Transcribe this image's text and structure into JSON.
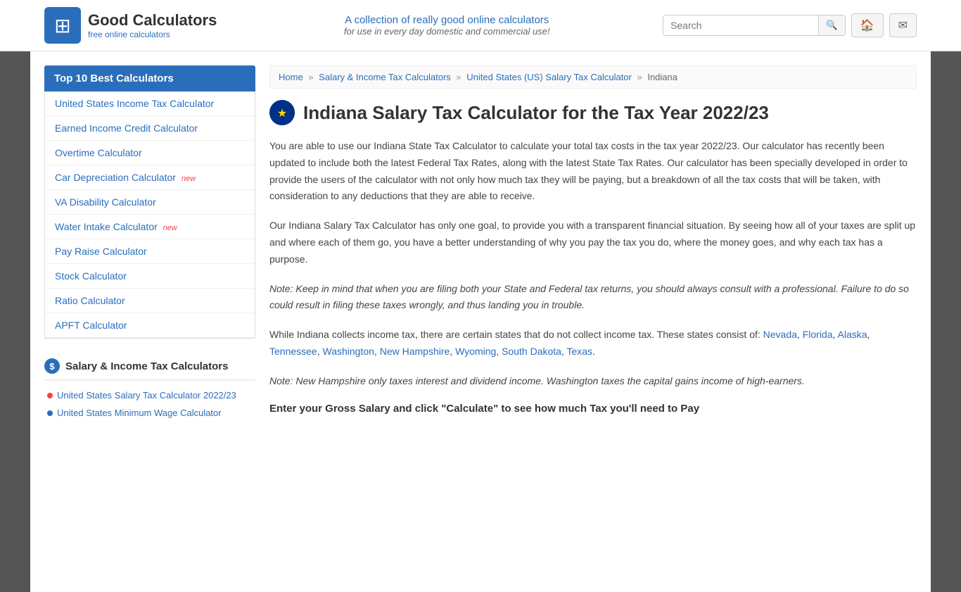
{
  "header": {
    "logo_name": "Good Calculators",
    "logo_sub": "free online calculators",
    "tagline_main": "A collection of really good online calculators",
    "tagline_sub": "for use in every day domestic and commercial use!",
    "search_placeholder": "Search",
    "search_btn_icon": "🔍",
    "home_icon": "🏠",
    "mail_icon": "✉"
  },
  "sidebar": {
    "section_title": "Top 10 Best Calculators",
    "items": [
      {
        "label": "United States Income Tax Calculator",
        "link": "#",
        "new": false
      },
      {
        "label": "Earned Income Credit Calculator",
        "link": "#",
        "new": false
      },
      {
        "label": "Overtime Calculator",
        "link": "#",
        "new": false
      },
      {
        "label": "Car Depreciation Calculator",
        "link": "#",
        "new": true
      },
      {
        "label": "VA Disability Calculator",
        "link": "#",
        "new": false
      },
      {
        "label": "Water Intake Calculator",
        "link": "#",
        "new": true
      },
      {
        "label": "Pay Raise Calculator",
        "link": "#",
        "new": false
      },
      {
        "label": "Stock Calculator",
        "link": "#",
        "new": false
      },
      {
        "label": "Ratio Calculator",
        "link": "#",
        "new": false
      },
      {
        "label": "APFT Calculator",
        "link": "#",
        "new": false
      }
    ],
    "section2_title": "Salary & Income Tax Calculators",
    "sublist": [
      {
        "label": "United States Salary Tax Calculator 2022/23",
        "dot": "red"
      },
      {
        "label": "United States Minimum Wage Calculator",
        "dot": "blue"
      }
    ]
  },
  "breadcrumb": {
    "home": "Home",
    "salary": "Salary & Income Tax Calculators",
    "us_salary": "United States (US) Salary Tax Calculator",
    "current": "Indiana"
  },
  "main": {
    "page_title": "Indiana Salary Tax Calculator for the Tax Year 2022/23",
    "flag_emoji": "🌟",
    "para1": "You are able to use our Indiana State Tax Calculator to calculate your total tax costs in the tax year 2022/23. Our calculator has recently been updated to include both the latest Federal Tax Rates, along with the latest State Tax Rates. Our calculator has been specially developed in order to provide the users of the calculator with not only how much tax they will be paying, but a breakdown of all the tax costs that will be taken, with consideration to any deductions that they are able to receive.",
    "para2": "Our Indiana Salary Tax Calculator has only one goal, to provide you with a transparent financial situation. By seeing how all of your taxes are split up and where each of them go, you have a better understanding of why you pay the tax you do, where the money goes, and why each tax has a purpose.",
    "note1": "Note: Keep in mind that when you are filing both your State and Federal tax returns, you should always consult with a professional. Failure to do so could result in filing these taxes wrongly, and thus landing you in trouble.",
    "para3_prefix": "While Indiana collects income tax, there are certain states that do not collect income tax. These states consist of: ",
    "states": [
      "Nevada",
      "Florida",
      "Alaska",
      "Tennessee",
      "Washington",
      "New Hampshire",
      "Wyoming",
      "South Dakota",
      "Texas"
    ],
    "note2": "Note: New Hampshire only taxes interest and dividend income. Washington taxes the capital gains income of high-earners.",
    "enter_salary_title": "Enter your Gross Salary and click \"Calculate\" to see how much Tax you'll need to Pay"
  }
}
